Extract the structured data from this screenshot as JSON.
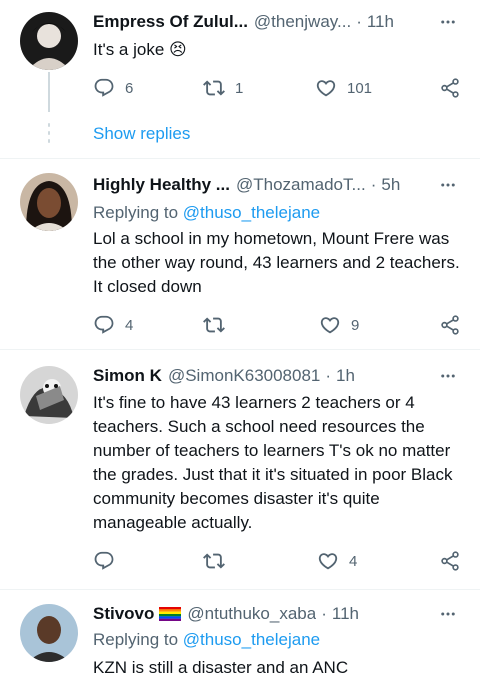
{
  "tweets": [
    {
      "name": "Empress Of Zulul...",
      "handle": "@thenjway...",
      "time": "11h",
      "text": "It's a joke 😣",
      "replies": "6",
      "retweets": "1",
      "likes": "101"
    },
    {
      "name": "Highly Healthy ...",
      "handle": "@ThozamadoT...",
      "time": "5h",
      "replying_prefix": "Replying to",
      "replying_to": "@thuso_thelejane",
      "text": "Lol a school in my hometown, Mount Frere was the other way round, 43 learners and 2 teachers. It closed down",
      "replies": "4",
      "retweets": "",
      "likes": "9"
    },
    {
      "name": "Simon K",
      "handle": "@SimonK63008081",
      "time": "1h",
      "text": "It's fine to have 43 learners 2 teachers or 4 teachers. Such a school need resources the number of teachers to learners T's ok no matter the grades. Just that it it's situated in poor Black community becomes disaster it's quite manageable actually.",
      "replies": "",
      "retweets": "",
      "likes": "4"
    },
    {
      "name": "Stivovo",
      "handle": "@ntuthuko_xaba",
      "time": "11h",
      "replying_prefix": "Replying to",
      "replying_to": "@thuso_thelejane",
      "text": "KZN is still a disaster and an ANC"
    }
  ],
  "show_replies_label": "Show replies",
  "separator": "·",
  "colors": {
    "accent": "#1d9bf0",
    "secondary_text": "#536471",
    "primary_text": "#0f1419",
    "divider": "#eff3f4"
  },
  "icons": [
    "reply-icon",
    "retweet-icon",
    "like-icon",
    "share-icon",
    "more-icon",
    "rainbow-flag-icon"
  ]
}
